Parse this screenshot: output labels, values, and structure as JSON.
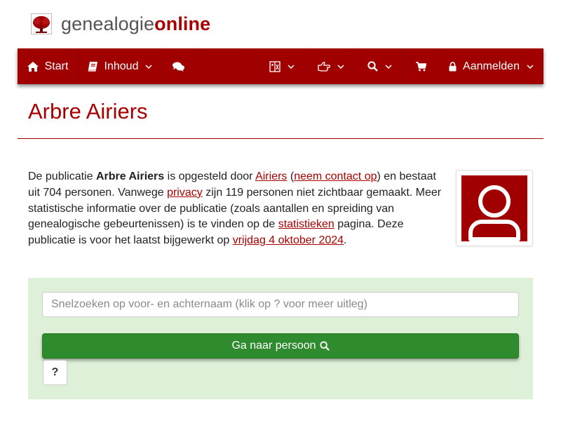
{
  "brand": {
    "part1": "genealogie",
    "part2": "online"
  },
  "nav": {
    "start_label": "Start",
    "inhoud_label": "Inhoud",
    "login_label": "Aanmelden",
    "icons": [
      "home-icon",
      "book-icon",
      "comments-icon",
      "language-icon",
      "hand-pointer-icon",
      "search-icon",
      "cart-icon",
      "lock-icon"
    ]
  },
  "page": {
    "title": "Arbre Airiers"
  },
  "intro": {
    "t1": "De publicatie ",
    "pub_name": "Arbre Airiers",
    "t2": " is opgesteld door ",
    "author_link": "Airiers",
    "t3": " (",
    "contact_link": "neem contact op",
    "t4": ") en bestaat uit 704 personen. Vanwege ",
    "privacy_link": "privacy",
    "t5": " zijn 119 personen niet zichtbaar gemaakt. Meer statistische informatie over de publicatie (zoals aantallen en spreiding van genealogische gebeurtenissen) is te vinden op de ",
    "stats_link": "statistieken",
    "t6": " pagina. Deze publicatie is voor het laatst bijgewerkt op ",
    "date_link": "vrijdag 4 oktober 2024",
    "t7": "."
  },
  "search": {
    "placeholder": "Snelzoeken op voor- en achternaam (klik op ? voor meer uitleg)",
    "button_label": "Ga naar persoon",
    "help_label": "?"
  },
  "colors": {
    "brand_red": "#a00000",
    "panel_green": "#dff0d8",
    "button_green": "#2e8b2e"
  }
}
